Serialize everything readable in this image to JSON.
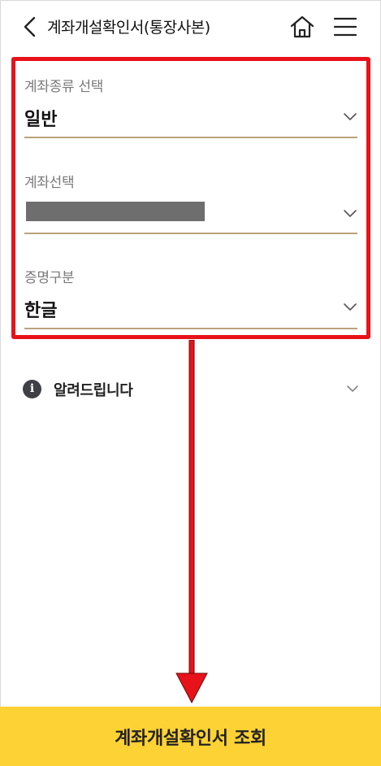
{
  "header": {
    "title": "계좌개설확인서(통장사본)",
    "back_icon": "chevron-left-icon",
    "home_icon": "home-icon",
    "menu_icon": "hamburger-menu-icon"
  },
  "form": {
    "account_type": {
      "label": "계좌종류 선택",
      "value": "일반"
    },
    "account_select": {
      "label": "계좌선택",
      "value_masked": true
    },
    "certificate_type": {
      "label": "증명구분",
      "value": "한글"
    }
  },
  "notice": {
    "label": "알려드립니다",
    "icon": "info-icon"
  },
  "submit": {
    "label": "계좌개설확인서 조회"
  },
  "colors": {
    "accent": "#fdd234",
    "underline": "#b9a37b",
    "highlight_border": "#e8121a",
    "arrow": "#e8121a"
  }
}
